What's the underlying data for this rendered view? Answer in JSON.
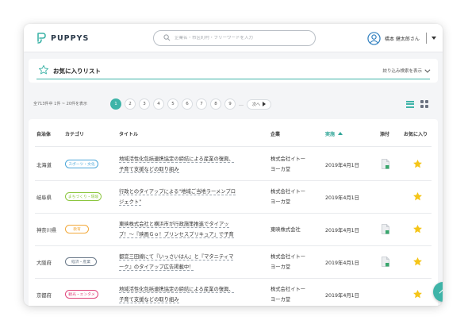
{
  "app": {
    "logo_text": "PUPPYS",
    "search_placeholder": "企業名・市区町村・フリーワードを入力",
    "user_name": "橋本 健太郎さん"
  },
  "favorites": {
    "title": "お気に入りリスト",
    "filter_label": "絞り込み検索を表示"
  },
  "pagination": {
    "summary": "全713件中 1件 ~ 20件を表示",
    "pages": [
      "1",
      "2",
      "3",
      "4",
      "5",
      "6",
      "7",
      "8",
      "9"
    ],
    "active_page": "1",
    "ellipsis": "…",
    "next_label": "次へ"
  },
  "table": {
    "headers": {
      "municipality": "自治体",
      "category": "カテゴリ",
      "title": "タイトル",
      "company": "企業",
      "date": "実施",
      "attachment": "添付",
      "favorite": "お気に入り"
    },
    "sorted_column": "date",
    "rows": [
      {
        "municipality": "北海道",
        "category": "スポーツ・文化",
        "category_color": "#4aa6d9",
        "title_lines": [
          "地域活性化包括連携協定の締結による産業の復興、",
          "子育て支援などの取り組み"
        ],
        "company_lines": [
          "株式会社イトー",
          "ヨーカ堂"
        ],
        "date": "2019年4月1日",
        "has_attachment": true
      },
      {
        "municipality": "岐阜県",
        "category": "まちづくり・環境",
        "category_color": "#8cc63f",
        "title_lines": [
          "行政とのタイアップによる\"地域ご当地ラーメンプロ",
          "ジェクト\""
        ],
        "company_lines": [
          "株式会社イトー",
          "ヨーカ堂"
        ],
        "date": "2019年4月1日",
        "has_attachment": false
      },
      {
        "municipality": "神奈川県",
        "category": "教育",
        "category_color": "#f2a93b",
        "title_lines": [
          "東映株式会社と横浜市が行政施策推進でタイアッ",
          "プ！～『映画Ｇｏ！プリンセスプリキュア』で子育"
        ],
        "company_lines": [
          "東映株式会社"
        ],
        "date": "2019年4月1日",
        "has_attachment": true
      },
      {
        "municipality": "大阪府",
        "category": "経済・産業",
        "category_color": "#6b7a8a",
        "title_lines": [
          "都営三田線にて『いっさいはん』と『マタニティマ",
          "ーク』のタイアップ広告掲載中！"
        ],
        "company_lines": [
          "株式会社イトー",
          "ヨーカ堂"
        ],
        "date": "2019年4月1日",
        "has_attachment": true
      },
      {
        "municipality": "京都府",
        "category": "観光・エンタメ",
        "category_color": "#e0457b",
        "title_lines": [
          "地域活性化包括連携協定の締結による産業の復興、",
          "子育て支援などの取り組み"
        ],
        "company_lines": [
          "株式会社イトー",
          "ヨーカ堂"
        ],
        "date": "2019年4月1日",
        "has_attachment": false
      }
    ]
  },
  "colors": {
    "accent": "#3fb4a8",
    "star": "#f5c518",
    "attachment_badge": "#3aa76d"
  },
  "icons": {
    "logo": "puppys-logo-icon",
    "search": "search-icon",
    "user": "user-avatar-icon",
    "favorite_outline": "star-outline-icon",
    "list_view": "list-view-icon",
    "grid_view": "grid-view-icon",
    "attachment": "document-icon",
    "favorite": "star-filled-icon",
    "scroll_top": "chevron-up-icon"
  }
}
